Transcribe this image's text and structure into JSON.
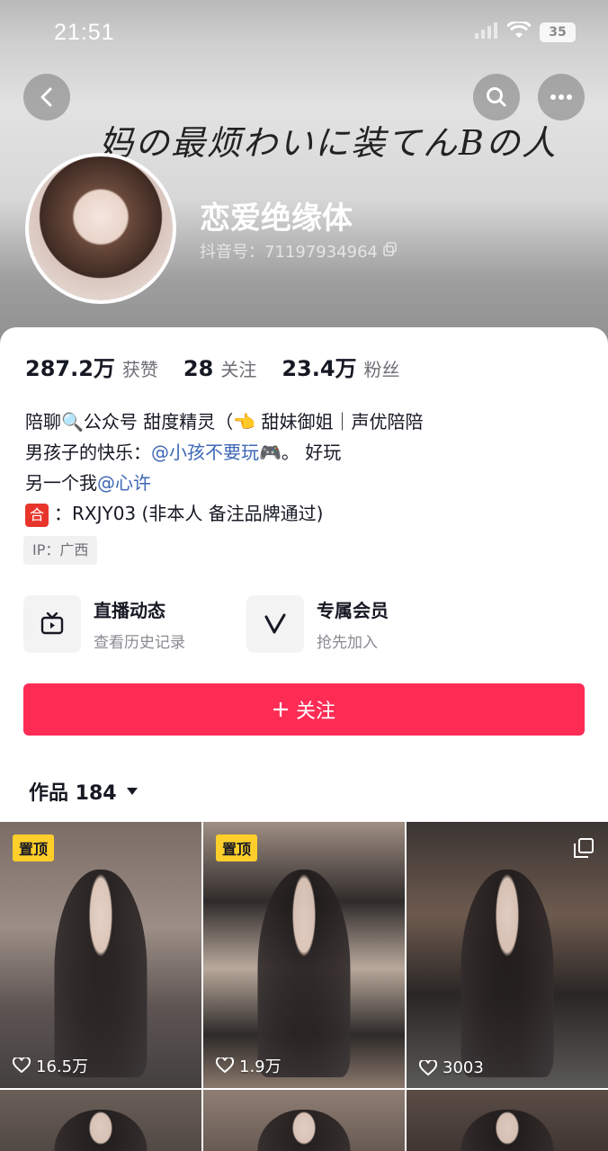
{
  "status_bar": {
    "time": "21:51",
    "battery": "35"
  },
  "header": {
    "banner_text": "妈の最烦わいに装てんBの人",
    "username": "恋爱绝缘体",
    "douyin_id": "抖音号：71197934964"
  },
  "stats": [
    {
      "value": "287.2万",
      "label": "获赞"
    },
    {
      "value": "28",
      "label": "关注"
    },
    {
      "value": "23.4万",
      "label": "粉丝"
    }
  ],
  "bio": {
    "line1": "陪聊🔍公众号  甜度精灵（👈 甜妹御姐｜声优陪陪",
    "line2_prefix": "男孩子的快乐：",
    "line2_mention": "@小孩不要玩🎮",
    "line2_suffix": "。 好玩",
    "line3_prefix": "另一个我",
    "line3_mention": "@心许",
    "line4_tag": "合",
    "line4_text": "：RXJY03 (非本人 备注品牌通过)"
  },
  "ip_tag": "IP：广西",
  "entries": [
    {
      "title": "直播动态",
      "subtitle": "查看历史记录",
      "icon": "tv-icon"
    },
    {
      "title": "专属会员",
      "subtitle": "抢先加入",
      "icon": "v-icon"
    }
  ],
  "follow_button": "关注",
  "works": {
    "label": "作品 184"
  },
  "videos": [
    {
      "pinned": "置顶",
      "likes": "16.5万"
    },
    {
      "pinned": "置顶",
      "likes": "1.9万"
    },
    {
      "pinned": "",
      "likes": "3003",
      "multi": true
    }
  ],
  "colors": {
    "accent": "#fe2c55",
    "mention": "#3d67b6",
    "pin": "#fece2b"
  }
}
